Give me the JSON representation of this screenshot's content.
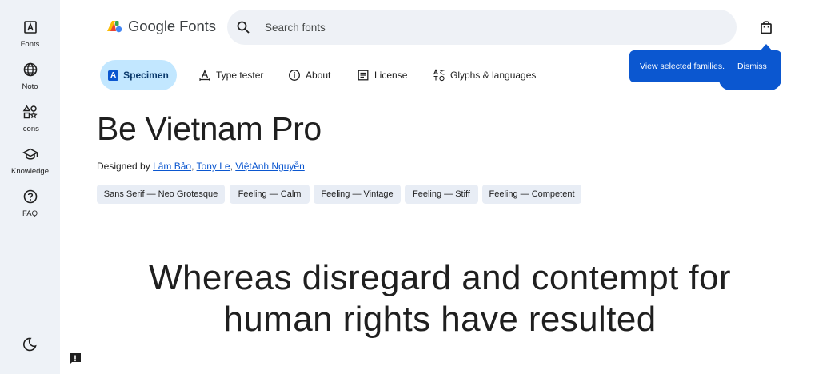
{
  "nav": {
    "items": [
      {
        "label": "Fonts",
        "icon": "font-icon"
      },
      {
        "label": "Noto",
        "icon": "globe-icon"
      },
      {
        "label": "Icons",
        "icon": "shapes-icon"
      },
      {
        "label": "Knowledge",
        "icon": "school-icon"
      },
      {
        "label": "FAQ",
        "icon": "help-icon"
      }
    ],
    "theme_icon": "dark-mode-icon",
    "feedback_icon": "feedback-icon"
  },
  "header": {
    "logo_text": "Google Fonts",
    "search_placeholder": "Search fonts",
    "bag_icon": "shopping-bag-icon"
  },
  "tabs": [
    {
      "label": "Specimen",
      "active": true
    },
    {
      "label": "Type tester"
    },
    {
      "label": "About"
    },
    {
      "label": "License"
    },
    {
      "label": "Glyphs & languages"
    }
  ],
  "toast": {
    "message": "View selected families.",
    "action": "Dismiss"
  },
  "font": {
    "name": "Be Vietnam Pro",
    "designed_by_prefix": "Designed by",
    "designers": [
      "Lâm Bảo",
      "Tony Le",
      "ViệtAnh Nguyễn"
    ],
    "tags": [
      "Sans Serif — Neo Grotesque",
      "Feeling — Calm",
      "Feeling — Vintage",
      "Feeling — Stiff",
      "Feeling — Competent"
    ]
  },
  "specimen": {
    "line1": "Whereas disregard and contempt for",
    "line2": "human rights have resulted"
  },
  "colors": {
    "accent": "#0b57d0",
    "active_tab_bg": "#c2e7ff",
    "rail_bg": "#eef2f7",
    "chip_bg": "#e8edf5"
  }
}
